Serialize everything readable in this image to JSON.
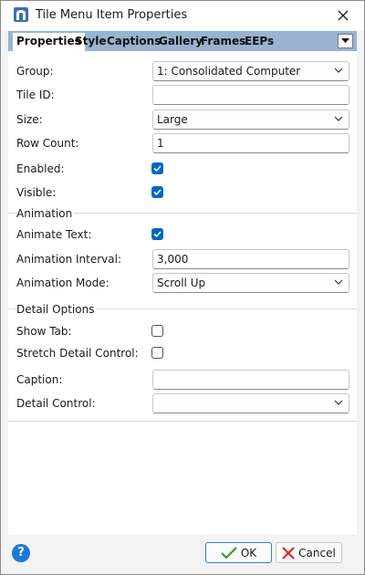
{
  "window": {
    "title": "Tile Menu Item Properties"
  },
  "tabs": [
    {
      "label": "Properties",
      "active": true
    },
    {
      "label": "Style"
    },
    {
      "label": "Captions"
    },
    {
      "label": "Gallery"
    },
    {
      "label": "Frames"
    },
    {
      "label": "EEPs"
    }
  ],
  "fields": {
    "group": {
      "label": "Group:",
      "value": "1: Consolidated Computer"
    },
    "tile_id": {
      "label": "Tile ID:",
      "value": ""
    },
    "size": {
      "label": "Size:",
      "value": "Large"
    },
    "row_count": {
      "label": "Row Count:",
      "value": "1"
    },
    "enabled": {
      "label": "Enabled:",
      "checked": true
    },
    "visible": {
      "label": "Visible:",
      "checked": true
    }
  },
  "animation": {
    "title": "Animation",
    "animate_text": {
      "label": "Animate Text:",
      "checked": true
    },
    "interval": {
      "label": "Animation Interval:",
      "value": "3,000"
    },
    "mode": {
      "label": "Animation Mode:",
      "value": "Scroll Up"
    }
  },
  "detail": {
    "title": "Detail Options",
    "show_tab": {
      "label": "Show Tab:",
      "checked": false
    },
    "stretch": {
      "label": "Stretch Detail Control:",
      "checked": false
    },
    "caption": {
      "label": "Caption:",
      "value": ""
    },
    "control": {
      "label": "Detail Control:",
      "value": ""
    }
  },
  "footer": {
    "help": "?",
    "ok_label": "OK",
    "cancel_label": "Cancel"
  },
  "colors": {
    "tab_strip": "#99b3d1",
    "checkbox_on": "#0067c0",
    "ok_icon": "#2e9d3a",
    "cancel_icon": "#d9262b"
  }
}
